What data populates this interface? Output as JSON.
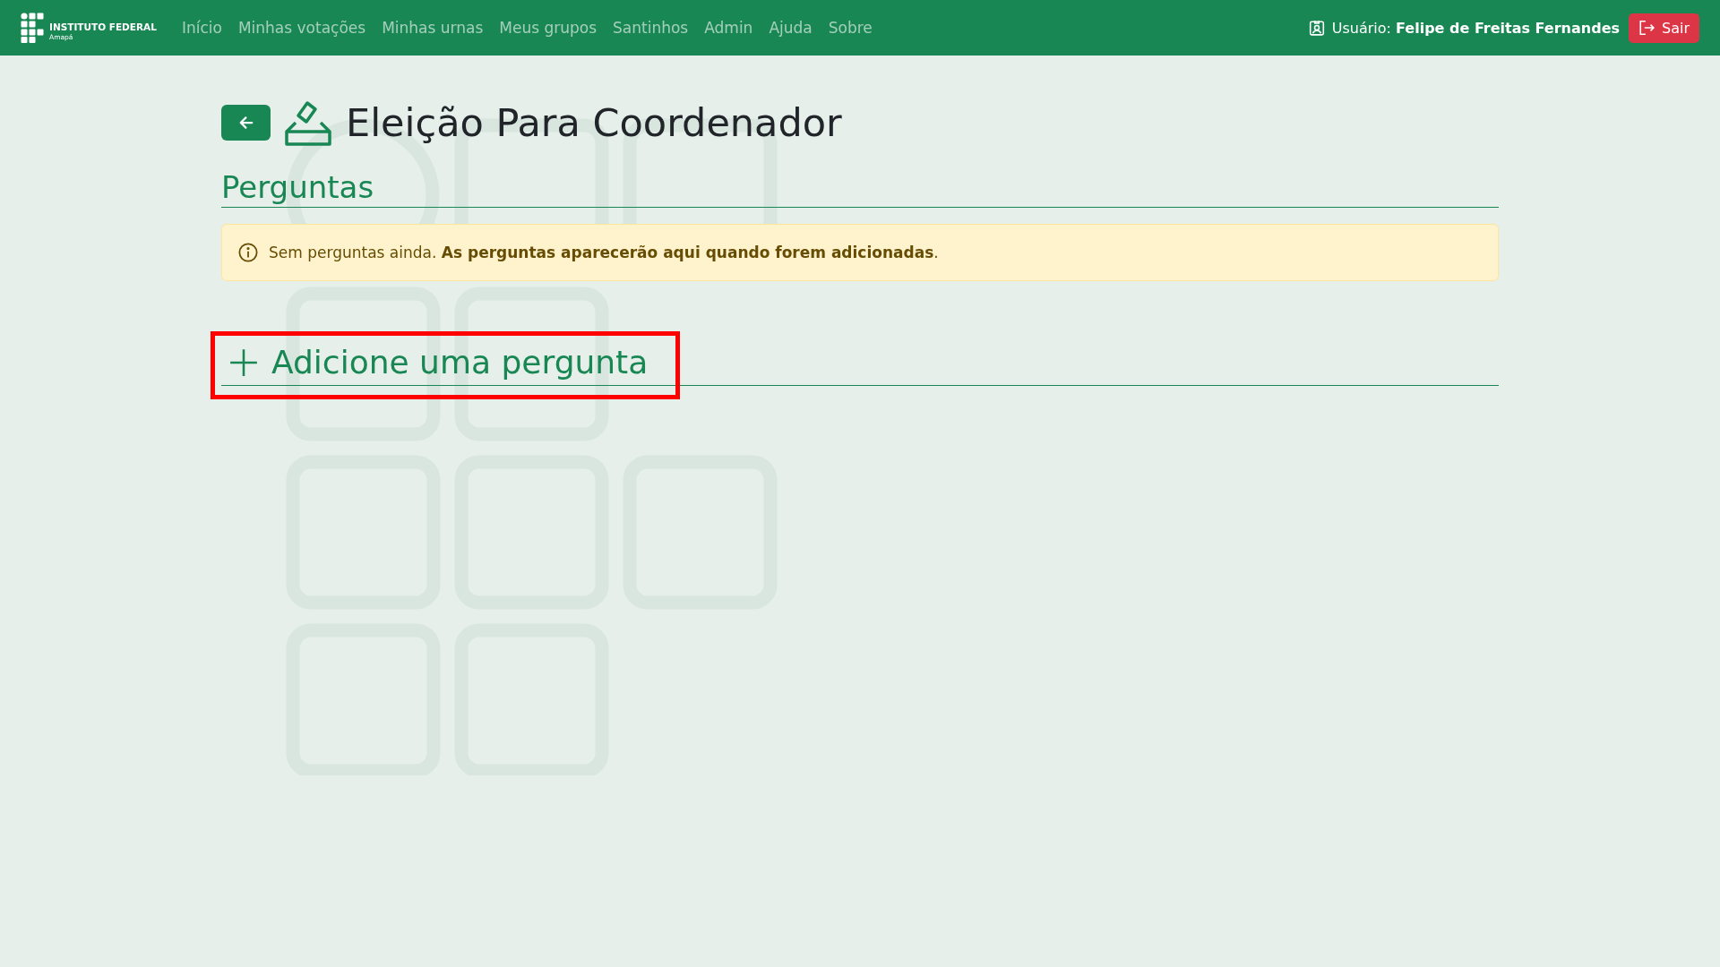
{
  "navbar": {
    "brand": {
      "name": "INSTITUTO FEDERAL",
      "campus": "Amapá"
    },
    "links": [
      {
        "label": "Início"
      },
      {
        "label": "Minhas votações"
      },
      {
        "label": "Minhas urnas"
      },
      {
        "label": "Meus grupos"
      },
      {
        "label": "Santinhos"
      },
      {
        "label": "Admin"
      },
      {
        "label": "Ajuda"
      },
      {
        "label": "Sobre"
      }
    ],
    "user": {
      "label": "Usuário:",
      "name": "Felipe de Freitas Fernandes"
    },
    "logout_button": "Sair"
  },
  "page": {
    "title": "Eleição Para Coordenador",
    "section_title": "Perguntas",
    "alert": {
      "text": "Sem perguntas ainda. **As perguntas aparecerão aqui quando forem adicionadas**."
    },
    "add_question": {
      "label": "Adicione uma pergunta",
      "highlighted": true
    }
  }
}
